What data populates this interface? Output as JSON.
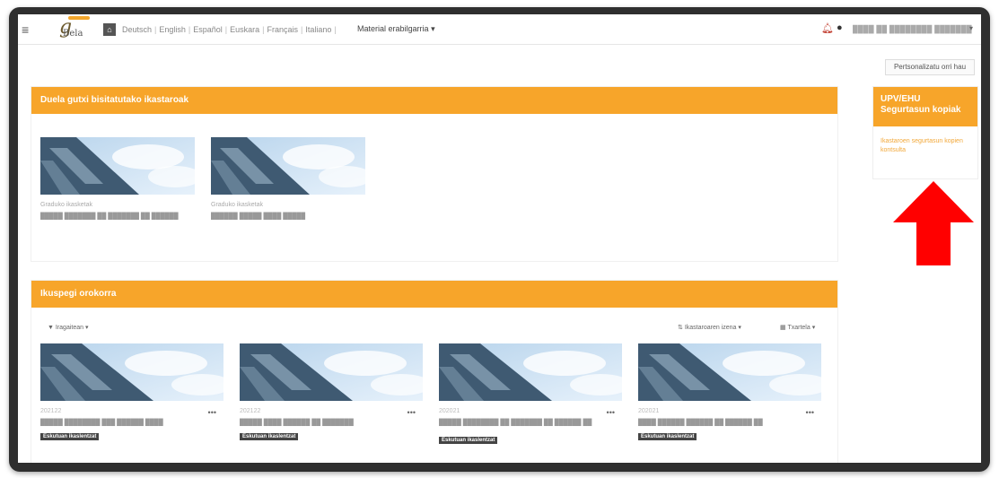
{
  "navbar": {
    "menu_icon": "hamburger-icon",
    "logo_main": "g",
    "logo_sub": "Bela",
    "languages": [
      "Deutsch",
      "English",
      "Español",
      "Euskara",
      "Français",
      "Italiano"
    ],
    "separator": "|",
    "material_menu": "Material erabilgarria",
    "caret": "▾",
    "username": "████ ██ ████████ ███████"
  },
  "customize_button": "Pertsonalizatu orri hau",
  "right_block": {
    "title": "UPV/EHU Segurtasun kopiak",
    "link": "Ikastaroen segurtasun kopien kontsulta"
  },
  "recent_section": {
    "title": "Duela gutxi bisitatutako ikastaroak",
    "courses": [
      {
        "category": "Graduko ikasketak",
        "name": "█████ ███████ ██ ███████ ██ ██████"
      },
      {
        "category": "Graduko ikasketak",
        "name": "██████ █████ ████ █████"
      }
    ]
  },
  "overview_section": {
    "title": "Ikuspegi orokorra",
    "filter_label": "Iragaitean",
    "sort_label": "Ikastaroaren izena",
    "view_label": "Txartela",
    "courses": [
      {
        "year": "202122",
        "name": "█████ ████████ ███ ██████ ████",
        "badge": "Eskutuan ikaslentzat"
      },
      {
        "year": "202122",
        "name": "█████ ████ ██████ ██ ███████",
        "badge": "Eskutuan ikaslentzat"
      },
      {
        "year": "202021",
        "name": "█████ ████████ ██ ███████ ██ ██████ ██",
        "badge": "Eskutuan ikaslentzat"
      },
      {
        "year": "202021",
        "name": "████ ██████ ██████ ██ ██████ ██",
        "badge": "Eskutuan ikaslentzat"
      }
    ]
  },
  "colors": {
    "accent": "#f7a52a",
    "arrow": "#ff0000"
  }
}
